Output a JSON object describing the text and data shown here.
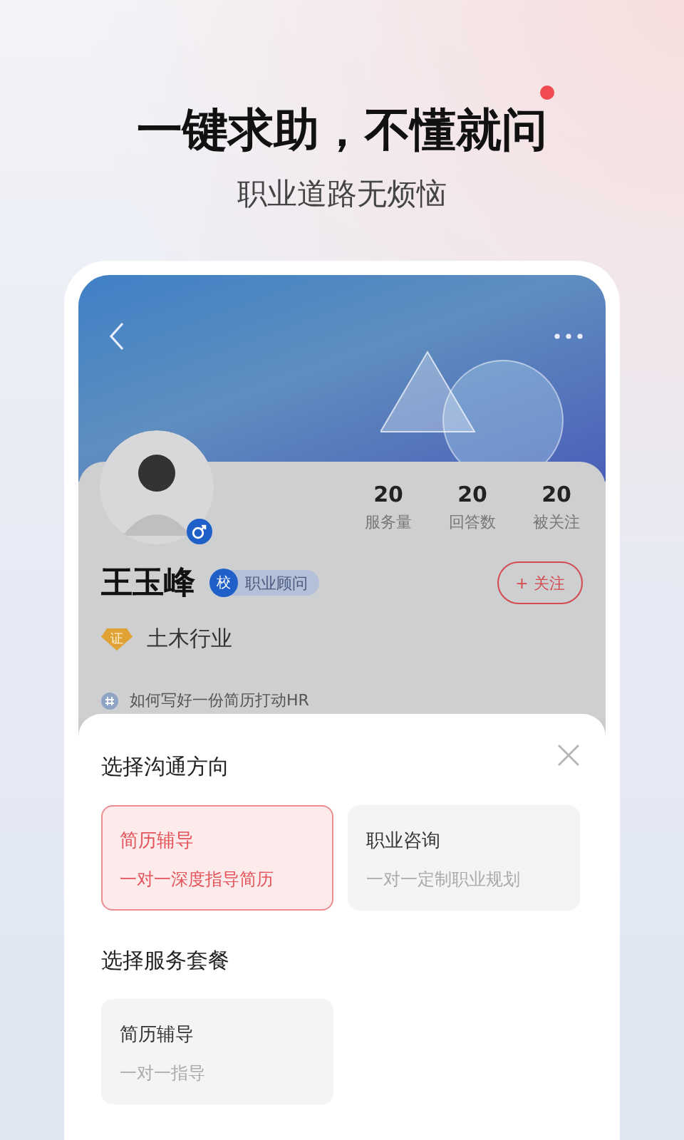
{
  "promo": {
    "headline": "一键求助，不懂就问",
    "subtitle": "职业道路无烦恼"
  },
  "profile": {
    "name": "王玉峰",
    "tag_icon": "校",
    "tag": "职业顾问",
    "follow": "+ 关注",
    "industry_icon": "证",
    "industry": "土木行业",
    "post": "如何写好一份简历打动HR",
    "stats": [
      {
        "value": "20",
        "label": "服务量"
      },
      {
        "value": "20",
        "label": "回答数"
      },
      {
        "value": "20",
        "label": "被关注"
      }
    ]
  },
  "sheet": {
    "direction_title": "选择沟通方向",
    "directions": [
      {
        "title": "简历辅导",
        "desc": "一对一深度指导简历",
        "selected": true
      },
      {
        "title": "职业咨询",
        "desc": "一对一定制职业规划",
        "selected": false
      }
    ],
    "package_title": "选择服务套餐",
    "packages": [
      {
        "title": "简历辅导",
        "desc": "一对一指导",
        "selected": false
      }
    ]
  }
}
